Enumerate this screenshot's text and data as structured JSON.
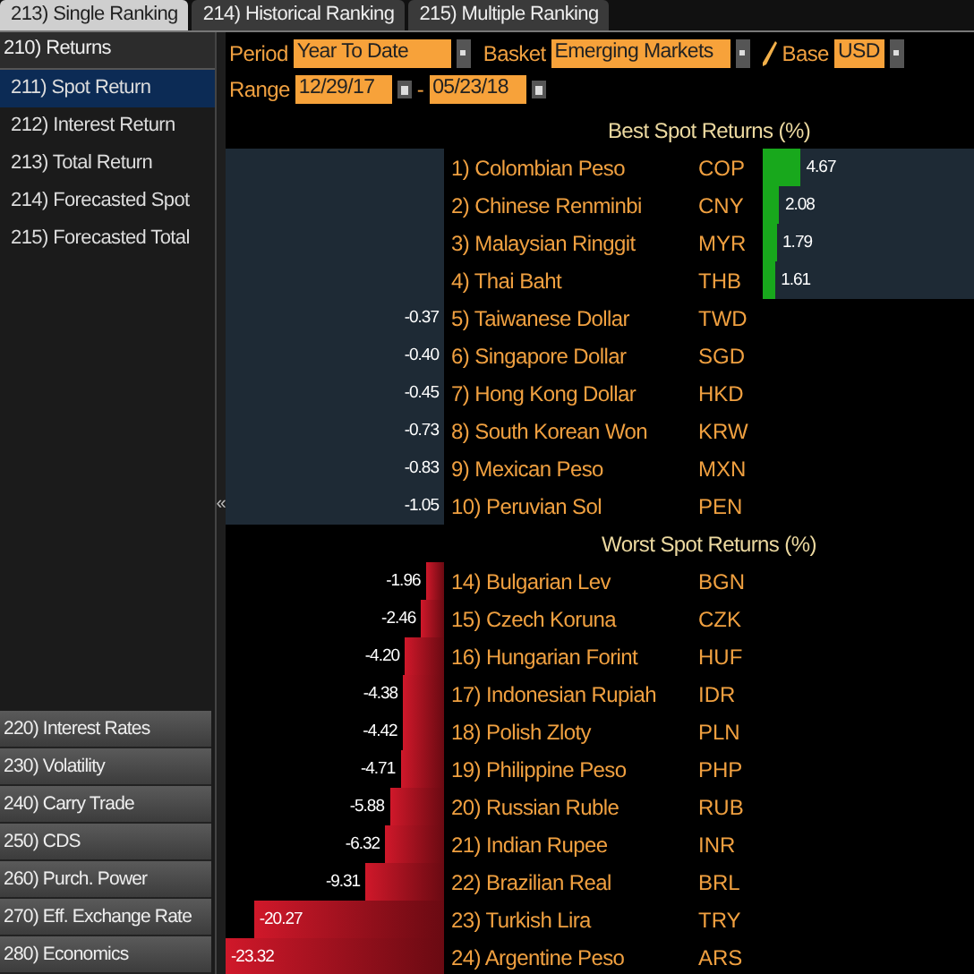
{
  "tabs": [
    {
      "label": "213) Single Ranking",
      "selected": true
    },
    {
      "label": "214) Historical Ranking",
      "selected": false
    },
    {
      "label": "215) Multiple Ranking",
      "selected": false
    }
  ],
  "sidebar": {
    "header": "210) Returns",
    "items": [
      {
        "label": "211) Spot Return",
        "selected": true
      },
      {
        "label": "212) Interest Return",
        "selected": false
      },
      {
        "label": "213) Total Return",
        "selected": false
      },
      {
        "label": "214) Forecasted Spot",
        "selected": false
      },
      {
        "label": "215) Forecasted Total",
        "selected": false
      }
    ],
    "collapse_glyph": "«",
    "buttons": [
      "220) Interest Rates",
      "230) Volatility",
      "240) Carry Trade",
      "250) CDS",
      "260) Purch. Power",
      "270) Eff. Exchange Rate",
      "280) Economics"
    ]
  },
  "controls": {
    "period": {
      "label": "Period",
      "value": "Year To Date"
    },
    "basket": {
      "label": "Basket",
      "value": "Emerging Markets"
    },
    "base": {
      "label": "Base",
      "value": "USD"
    },
    "range": {
      "label": "Range",
      "from": "12/29/17",
      "separator": "-",
      "to": "05/23/18"
    }
  },
  "sections": [
    {
      "kind": "best",
      "title": "Best Spot Returns (%)",
      "rows": [
        {
          "rank": "1)",
          "name": "Colombian Peso",
          "code": "COP",
          "value": "4.67",
          "kind": "gain",
          "level": 0.18
        },
        {
          "rank": "2)",
          "name": "Chinese Renminbi",
          "code": "CNY",
          "value": "2.08",
          "kind": "gain",
          "level": 0.08
        },
        {
          "rank": "3)",
          "name": "Malaysian Ringgit",
          "code": "MYR",
          "value": "1.79",
          "kind": "gain",
          "level": 0.068
        },
        {
          "rank": "4)",
          "name": "Thai Baht",
          "code": "THB",
          "value": "1.61",
          "kind": "gain",
          "level": 0.06
        },
        {
          "rank": "5)",
          "name": "Taiwanese Dollar",
          "code": "TWD",
          "value": "-0.37",
          "kind": "loss"
        },
        {
          "rank": "6)",
          "name": "Singapore Dollar",
          "code": "SGD",
          "value": "-0.40",
          "kind": "loss"
        },
        {
          "rank": "7)",
          "name": "Hong Kong Dollar",
          "code": "HKD",
          "value": "-0.45",
          "kind": "loss"
        },
        {
          "rank": "8)",
          "name": "South Korean Won",
          "code": "KRW",
          "value": "-0.73",
          "kind": "loss"
        },
        {
          "rank": "9)",
          "name": "Mexican Peso",
          "code": "MXN",
          "value": "-0.83",
          "kind": "loss"
        },
        {
          "rank": "10)",
          "name": "Peruvian Sol",
          "code": "PEN",
          "value": "-1.05",
          "kind": "loss"
        }
      ]
    },
    {
      "kind": "worst",
      "title": "Worst Spot Returns (%)",
      "rows": [
        {
          "rank": "14)",
          "name": "Bulgarian Lev",
          "code": "BGN",
          "value": "-1.96",
          "kind": "loss",
          "level": 0.084
        },
        {
          "rank": "15)",
          "name": "Czech Koruna",
          "code": "CZK",
          "value": "-2.46",
          "kind": "loss",
          "level": 0.105
        },
        {
          "rank": "16)",
          "name": "Hungarian Forint",
          "code": "HUF",
          "value": "-4.20",
          "kind": "loss",
          "level": 0.18
        },
        {
          "rank": "17)",
          "name": "Indonesian Rupiah",
          "code": "IDR",
          "value": "-4.38",
          "kind": "loss",
          "level": 0.188
        },
        {
          "rank": "18)",
          "name": "Polish Zloty",
          "code": "PLN",
          "value": "-4.42",
          "kind": "loss",
          "level": 0.19
        },
        {
          "rank": "19)",
          "name": "Philippine Peso",
          "code": "PHP",
          "value": "-4.71",
          "kind": "loss",
          "level": 0.2
        },
        {
          "rank": "20)",
          "name": "Russian Ruble",
          "code": "RUB",
          "value": "-5.88",
          "kind": "loss",
          "level": 0.25
        },
        {
          "rank": "21)",
          "name": "Indian Rupee",
          "code": "INR",
          "value": "-6.32",
          "kind": "loss",
          "level": 0.27
        },
        {
          "rank": "22)",
          "name": "Brazilian Real",
          "code": "BRL",
          "value": "-9.31",
          "kind": "loss",
          "level": 0.36
        },
        {
          "rank": "23)",
          "name": "Turkish Lira",
          "code": "TRY",
          "value": "-20.27",
          "kind": "loss",
          "level": 0.87
        },
        {
          "rank": "24)",
          "name": "Argentine Peso",
          "code": "ARS",
          "value": "-23.32",
          "kind": "loss",
          "level": 1
        }
      ]
    }
  ]
}
